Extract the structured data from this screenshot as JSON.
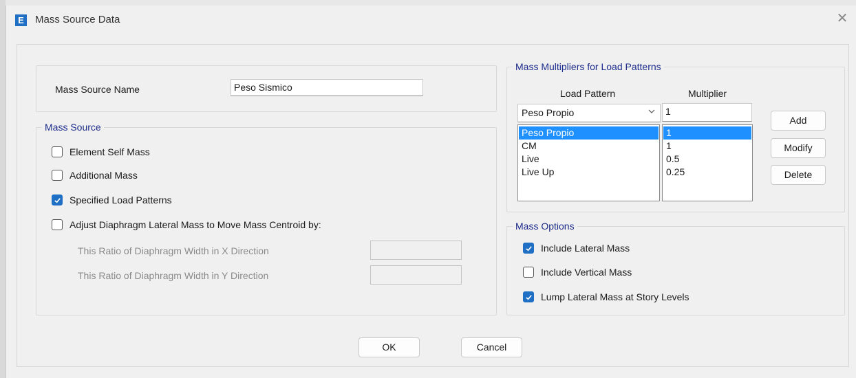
{
  "window": {
    "title": "Mass Source Data",
    "icon_letter": "E",
    "close_glyph": "✕"
  },
  "name_section": {
    "label": "Mass Source Name",
    "value": "Peso Sismico"
  },
  "mass_source": {
    "legend": "Mass Source",
    "element_self_mass": {
      "label": "Element Self Mass",
      "checked": false
    },
    "additional_mass": {
      "label": "Additional Mass",
      "checked": false
    },
    "specified_load_patterns": {
      "label": "Specified Load Patterns",
      "checked": true
    },
    "adjust_diaphragm": {
      "label": "Adjust Diaphragm Lateral Mass to Move Mass Centroid by:",
      "checked": false
    },
    "ratio_x_label": "This Ratio of Diaphragm Width in X Direction",
    "ratio_y_label": "This Ratio of Diaphragm Width in Y Direction",
    "ratio_x_value": "",
    "ratio_y_value": ""
  },
  "multipliers": {
    "legend": "Mass Multipliers for Load Patterns",
    "col_load_pattern": "Load Pattern",
    "col_multiplier": "Multiplier",
    "selected_pattern": "Peso Propio",
    "multiplier_input": "1",
    "rows": [
      {
        "pattern": "Peso Propio",
        "multiplier": "1"
      },
      {
        "pattern": "CM",
        "multiplier": "1"
      },
      {
        "pattern": "Live",
        "multiplier": "0.5"
      },
      {
        "pattern": "Live Up",
        "multiplier": "0.25"
      }
    ],
    "add_label": "Add",
    "modify_label": "Modify",
    "delete_label": "Delete"
  },
  "mass_options": {
    "legend": "Mass Options",
    "include_lateral": {
      "label": "Include Lateral Mass",
      "checked": true
    },
    "include_vertical": {
      "label": "Include Vertical Mass",
      "checked": false
    },
    "lump_lateral": {
      "label": "Lump Lateral Mass at Story Levels",
      "checked": true
    }
  },
  "footer": {
    "ok_label": "OK",
    "cancel_label": "Cancel"
  },
  "colors": {
    "accent": "#1f6fc5",
    "selection": "#1e90ff",
    "legend_text": "#1c2c8c"
  }
}
